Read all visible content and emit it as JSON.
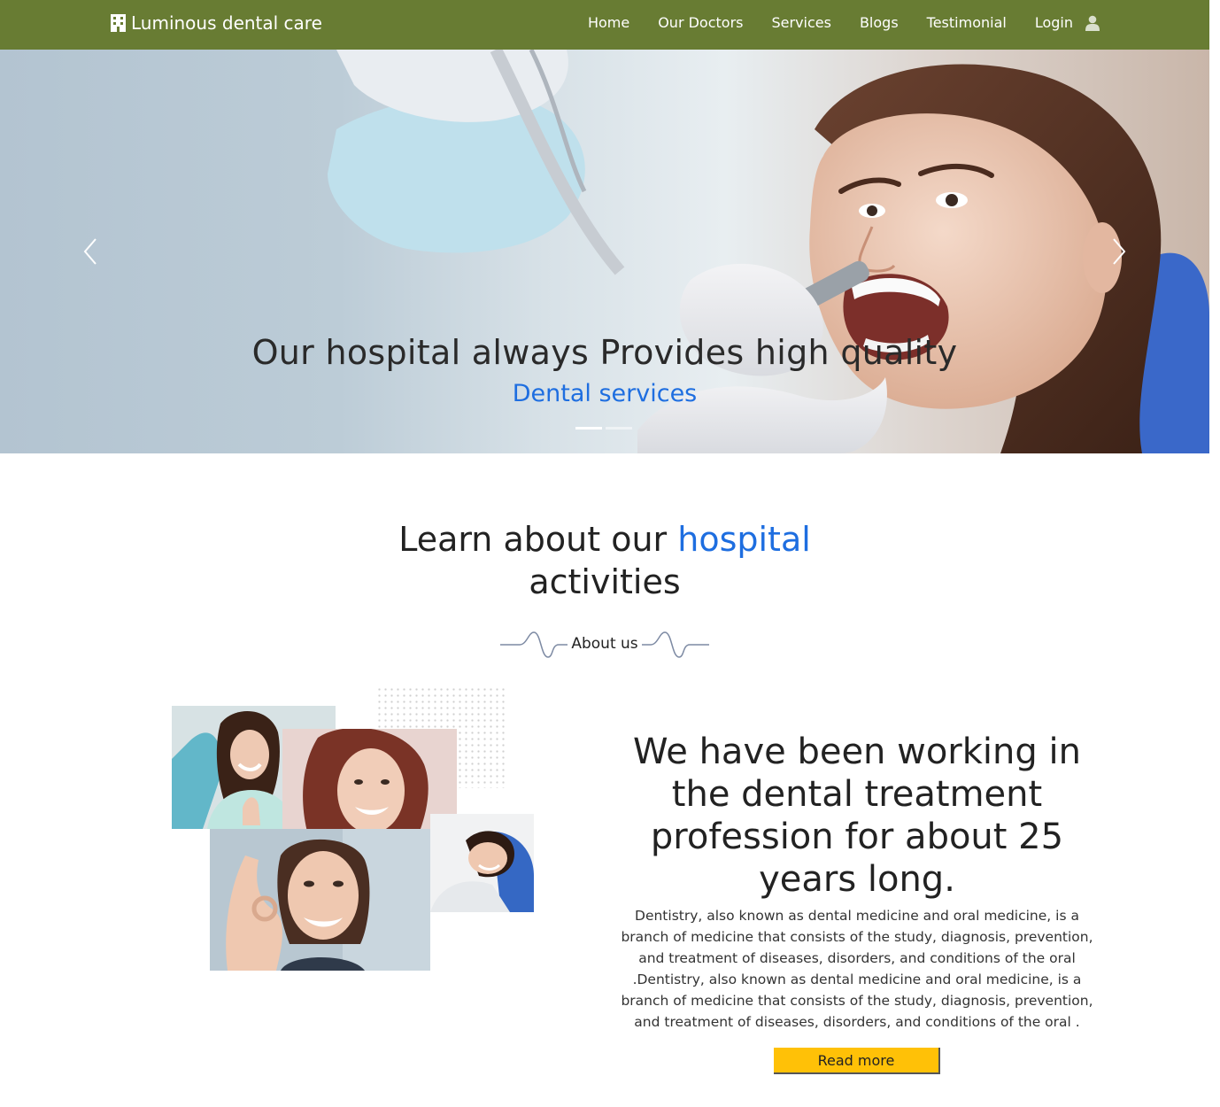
{
  "navbar": {
    "brand": "Luminous dental care",
    "brand_icon": "hospital-building-icon",
    "background": "#687c33",
    "links": [
      "Home",
      "Our Doctors",
      "Services",
      "Blogs",
      "Testimonial",
      "Login"
    ],
    "login_icon": "user-icon"
  },
  "hero": {
    "title": "Our hospital always Provides high quality",
    "subtitle": "Dental services",
    "subtitle_color": "#1e6ee0",
    "prev_icon": "chevron-left-icon",
    "next_icon": "chevron-right-icon",
    "slide_count": 2,
    "active_slide": 1
  },
  "about": {
    "title_part1": "Learn about our",
    "title_accent": "hospital",
    "title_part2": "activities",
    "label": "About us",
    "heading": "We have been working in the dental treatment profession for about 25 years long.",
    "body": "Dentistry, also known as dental medicine and oral medicine, is a branch of medicine that consists of the study, diagnosis, prevention, and treatment of diseases, disorders, and conditions of the oral .Dentistry, also known as dental medicine and oral medicine, is a branch of medicine that consists of the study, diagnosis, prevention, and treatment of diseases, disorders, and conditions of the oral .",
    "read_more": "Read more",
    "button_color": "#ffc107"
  }
}
